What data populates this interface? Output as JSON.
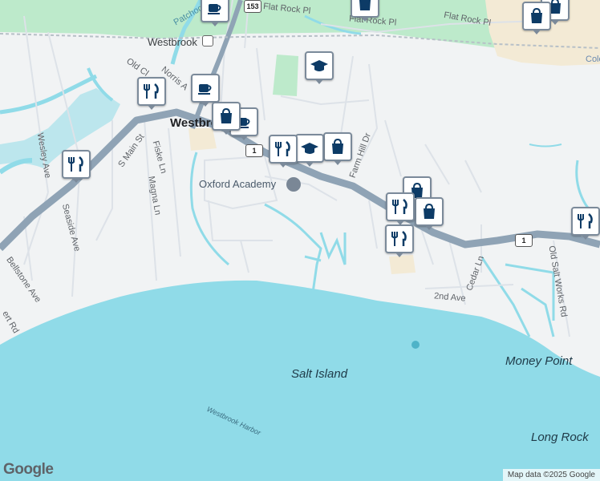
{
  "map": {
    "colors": {
      "land": "#f1f3f4",
      "water": "#90dbe8",
      "park": "#bdeacb",
      "highway": "#8fa3b5",
      "road": "#dde2e8",
      "pin_fill": "#0d3b66"
    },
    "labels": {
      "flat_rock_1": "Flat Rock Pl",
      "flat_rock_2": "Flat Rock Pl",
      "flat_rock_3": "Flat Rock Pl",
      "westbrook_station": "Westbrook",
      "westbrook_town": "Westbrook",
      "patchogue": "Patchogue",
      "old_clinton": "Old Cl",
      "norris": "Norris A",
      "s_main": "S Main St",
      "fiske": "Fiske Ln",
      "magna": "Magna Ln",
      "wesley": "Wesley Ave",
      "seaside": "Seaside Ave",
      "bellstone": "Bellstone Ave",
      "pent_rd": "ert Rd",
      "oxford": "Oxford Academy",
      "farm_hill": "Farm Hill Dr",
      "cedar": "Cedar Ln",
      "second_ave": "2nd Ave",
      "old_salt": "Old Salt Works Rd",
      "salt_island": "Salt Island",
      "money_point": "Money Point",
      "long_rock": "Long Rock",
      "westbrook_harbor": "Westbrook Harbor",
      "colo": "Colo"
    },
    "shields": {
      "route_153": "153",
      "route_1_a": "1",
      "route_1_b": "1"
    },
    "branding": {
      "google": "Google",
      "attribution": "Map data ©2025 Google"
    }
  }
}
